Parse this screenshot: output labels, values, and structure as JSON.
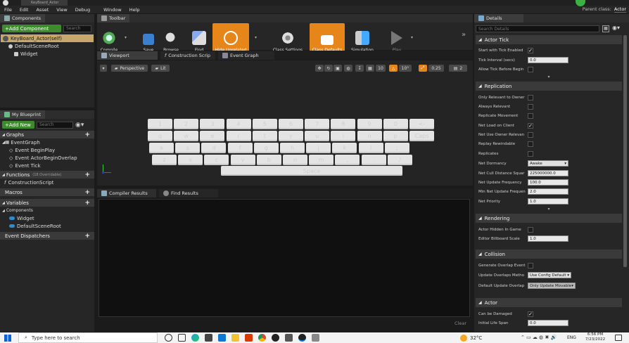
{
  "title_tab": "KeyBoard_Actor",
  "menu": [
    "File",
    "Edit",
    "Asset",
    "View",
    "Debug",
    "Window",
    "Help"
  ],
  "parent_class_label": "Parent class:",
  "parent_class_value": "Actor",
  "components": {
    "tab": "Components",
    "add_button": "+Add Component",
    "search_placeholder": "Search",
    "root": "KeyBoard_Actor(self)",
    "items": [
      "DefaultSceneRoot",
      "Widget"
    ]
  },
  "my_blueprint": {
    "tab": "My Blueprint",
    "add_button": "+Add New",
    "search_placeholder": "Search",
    "graphs_label": "Graphs",
    "event_graph": "EventGraph",
    "events": [
      "Event BeginPlay",
      "Event ActorBeginOverlap",
      "Event Tick"
    ],
    "functions_label": "Functions",
    "functions_override": "(18 Overridable)",
    "construction": "ConstructionScript",
    "macros_label": "Macros",
    "variables_label": "Variables",
    "components_label": "Components",
    "var_items": [
      "Widget",
      "DefaultSceneRoot"
    ],
    "dispatchers_label": "Event Dispatchers"
  },
  "toolbar": {
    "tab": "Toolbar",
    "buttons": [
      "Compile",
      "Save",
      "Browse",
      "Find",
      "Hide Unrelated",
      "Class Settings",
      "Class Defaults",
      "Simulation",
      "Play"
    ]
  },
  "editor_tabs": [
    "Viewport",
    "Construction Script",
    "Event Graph"
  ],
  "viewport": {
    "perspective": "Perspective",
    "lit": "Lit",
    "grid_snap": "10",
    "rot_snap": "10°",
    "scale_snap": "0.25",
    "cam_speed": "2"
  },
  "keyboard": {
    "row1": [
      "1",
      "2",
      "3",
      "4",
      "5",
      "6",
      "7",
      "8",
      "9",
      "0",
      "<-"
    ],
    "row2": [
      "q",
      "w",
      "e",
      "r",
      "t",
      "y",
      "u",
      "i",
      "o",
      "p",
      "Caps"
    ],
    "row3": [
      "a",
      "s",
      "d",
      "f",
      "g",
      "h",
      "j",
      "k",
      "l",
      ";"
    ],
    "row4": [
      "z",
      "x",
      "c",
      "v",
      "b",
      "n",
      "m",
      ",",
      ".",
      "/"
    ],
    "space": "Space"
  },
  "bottom_tabs": [
    "Compiler Results",
    "Find Results"
  ],
  "clear_label": "Clear",
  "details": {
    "tab": "Details",
    "search_placeholder": "Search Details",
    "sections": {
      "actor_tick": "Actor Tick",
      "replication": "Replication",
      "rendering": "Rendering",
      "collision": "Collision",
      "actor": "Actor"
    },
    "start_with_tick": "Start with Tick Enabled",
    "tick_interval": "Tick Interval (secs)",
    "tick_interval_val": "0.0",
    "allow_tick": "Allow Tick Before Begin",
    "only_relevant": "Only Relevant to Owner",
    "always_relevant": "Always Relevant",
    "replicate_movement": "Replicate Movement",
    "net_load": "Net Load on Client",
    "net_use_owner": "Net Use Owner Relevan",
    "replay_rewindable": "Replay Rewindable",
    "replicates": "Replicates",
    "net_dormancy": "Net Dormancy",
    "net_dormancy_val": "Awake",
    "net_cull": "Net Cull Distance Squar",
    "net_cull_val": "225000000.0",
    "net_update_freq": "Net Update Frequency",
    "net_update_freq_val": "100.0",
    "min_net_update": "Min Net Update Frequen",
    "min_net_update_val": "2.0",
    "net_priority": "Net Priority",
    "net_priority_val": "1.0",
    "hidden_in_game": "Actor Hidden In Game",
    "billboard_scale": "Editor Billboard Scale",
    "billboard_scale_val": "1.0",
    "gen_overlap": "Generate Overlap Event",
    "update_overlaps": "Update Overlaps Metho",
    "update_overlaps_val": "Use Config Default",
    "default_update": "Default Update Overlap",
    "default_update_val": "Only Update Movable",
    "can_be_damaged": "Can be Damaged",
    "initial_life": "Initial Life Span",
    "initial_life_val": "0.0"
  },
  "taskbar": {
    "search_placeholder": "Type here to search",
    "temp": "32°C",
    "lang": "ENG",
    "time": "6:56 PM",
    "date": "7/23/2022"
  }
}
